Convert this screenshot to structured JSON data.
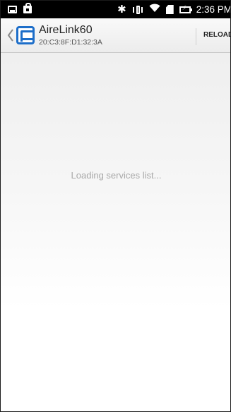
{
  "status_bar": {
    "time": "2:36 PM",
    "left_icons": [
      "gallery-icon",
      "shopping-bag-icon"
    ],
    "right_icons": [
      "bluetooth-icon",
      "vibrate-icon",
      "wifi-icon",
      "sim-card-icon",
      "battery-charging-icon"
    ]
  },
  "action_bar": {
    "title": "AireLink60",
    "subtitle": "20:C3:8F:D1:32:3A",
    "reload_label": "RELOAD",
    "app_icon": "airelink-logo-icon",
    "accent_color": "#1d6ec9"
  },
  "main": {
    "loading_text": "Loading services list..."
  }
}
